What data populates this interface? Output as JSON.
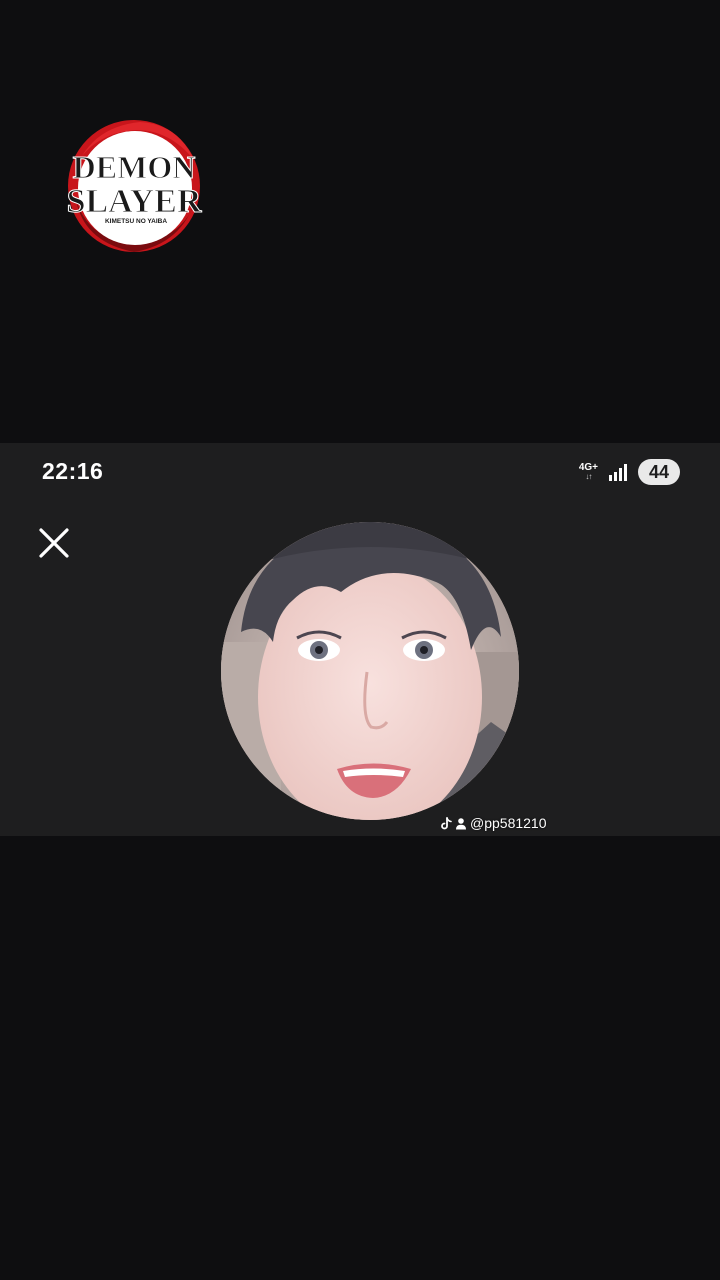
{
  "logo": {
    "line1": "DEMON",
    "line2": "SLAYER",
    "subtitle": "KIMETSU NO YAIBA"
  },
  "status_bar": {
    "time": "22:16",
    "network_type": "4G+",
    "data_arrows": "↓↑",
    "signal_icon": "signal-bars-icon",
    "battery": "44"
  },
  "close_icon": "close-x-icon",
  "profile": {
    "avatar_icon": "profile-photo"
  },
  "watermark": {
    "platform_icon": "tiktok-icon",
    "user_icon": "person-icon",
    "handle": "@pp581210"
  },
  "colors": {
    "page_background": "#0e0e10",
    "frame_background": "#1e1e1f",
    "logo_red": "#c8151b",
    "battery_badge": "#e9e9e9"
  }
}
